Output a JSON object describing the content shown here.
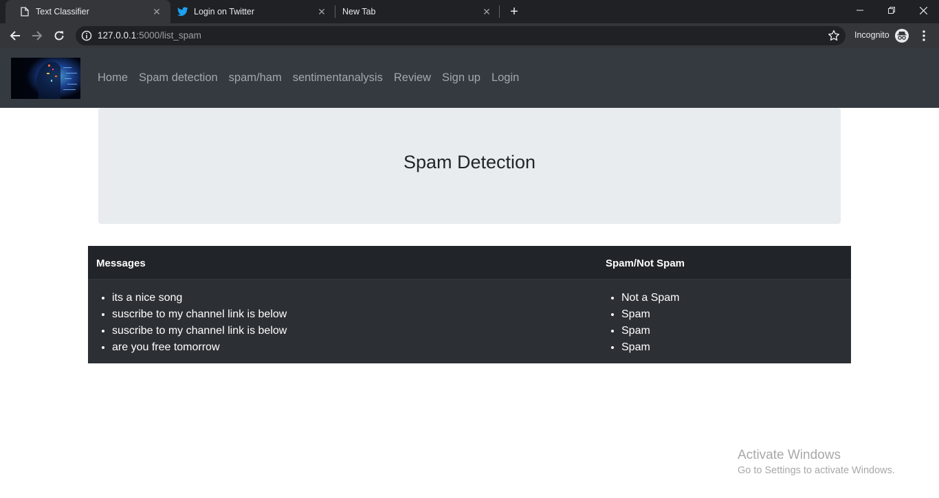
{
  "browser": {
    "tabs": [
      {
        "title": "Text Classifier",
        "icon": "page-icon",
        "active": true
      },
      {
        "title": "Login on Twitter",
        "icon": "twitter-icon",
        "active": false
      },
      {
        "title": "New Tab",
        "icon": "",
        "active": false
      }
    ],
    "new_tab_symbol": "+",
    "close_symbol": "✕",
    "url_host": "127.0.0.1",
    "url_rest": ":5000/list_spam",
    "incognito_label": "Incognito"
  },
  "site": {
    "nav_links": [
      "Home",
      "Spam detection",
      "spam/ham",
      "sentimentanalysis",
      "Review",
      "Sign up",
      "Login"
    ],
    "page_title": "Spam Detection"
  },
  "table": {
    "headers": [
      "Messages",
      "Spam/Not Spam"
    ],
    "messages": [
      "its a nice song",
      "suscribe to my channel link is below",
      "suscribe to my channel link is below",
      "are you free tomorrow"
    ],
    "labels": [
      "Not a Spam",
      "Spam",
      "Spam",
      "Spam"
    ]
  },
  "watermark": {
    "line1": "Activate Windows",
    "line2": "Go to Settings to activate Windows."
  },
  "colors": {
    "navbar": "#343a40",
    "jumbotron": "#e9ecef",
    "table_dark": "#212529",
    "twitter_blue": "#1da1f2"
  }
}
